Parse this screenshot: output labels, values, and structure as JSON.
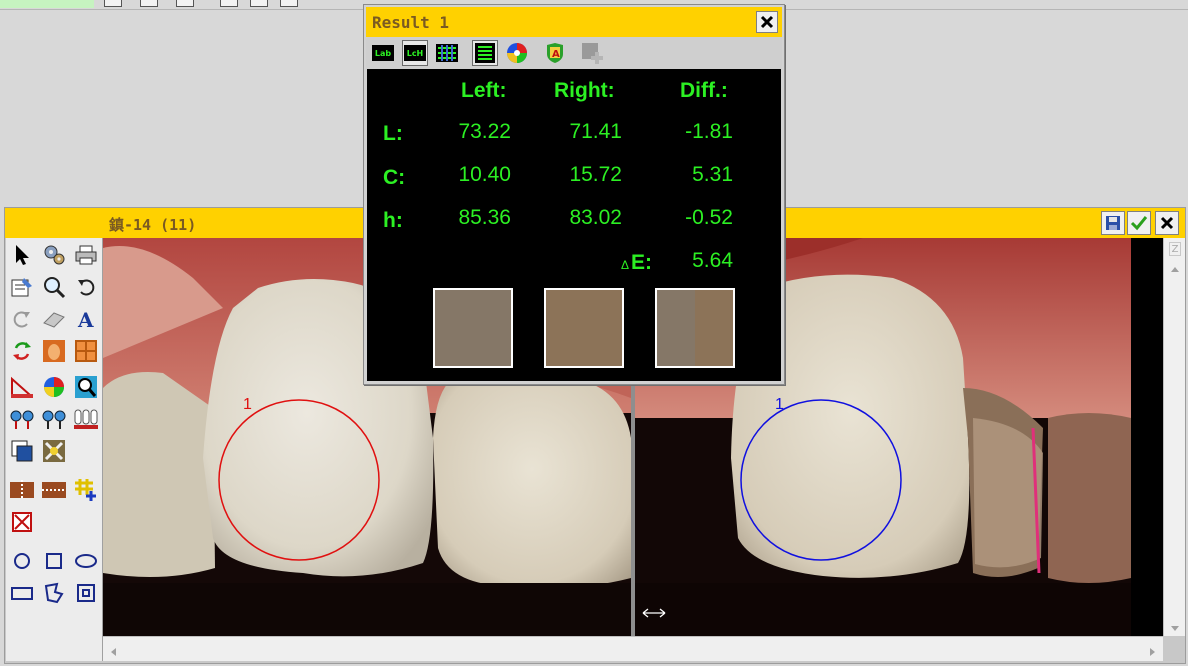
{
  "result_window": {
    "title": "Result 1",
    "close_label": "✕",
    "toolbar": [
      {
        "name": "lab-mode-button",
        "label": "Lab"
      },
      {
        "name": "lch-mode-button",
        "label": "LcH"
      },
      {
        "name": "grid-mode-button",
        "label": ""
      },
      {
        "name": "list-view-button",
        "label": ""
      },
      {
        "name": "color-wheel-button",
        "label": ""
      },
      {
        "name": "shield-a-button",
        "label": "A"
      },
      {
        "name": "add-disabled-button",
        "label": ""
      }
    ],
    "headers": {
      "left": "Left:",
      "right": "Right:",
      "diff": "Diff.:"
    },
    "rows": [
      {
        "label": "L:",
        "left": "73.22",
        "right": "71.41",
        "diff": "-1.81"
      },
      {
        "label": "C:",
        "left": "10.40",
        "right": "15.72",
        "diff": "5.31"
      },
      {
        "label": "h:",
        "left": "85.36",
        "right": "83.02",
        "diff": "-0.52"
      }
    ],
    "delta_e": {
      "delta": "Δ",
      "label": "E:",
      "value": "5.64"
    },
    "swatch_colors": {
      "left": "#857767",
      "right": "#8c7358",
      "diff_left": "#857767",
      "diff_right": "#8c7358"
    }
  },
  "image_window": {
    "title": "鎮-14 (11)",
    "left_marker_label": "1",
    "right_marker_label": "1",
    "marker_colors": {
      "left": "#e01010",
      "right": "#1010e0"
    },
    "accent": "#ffd100"
  }
}
